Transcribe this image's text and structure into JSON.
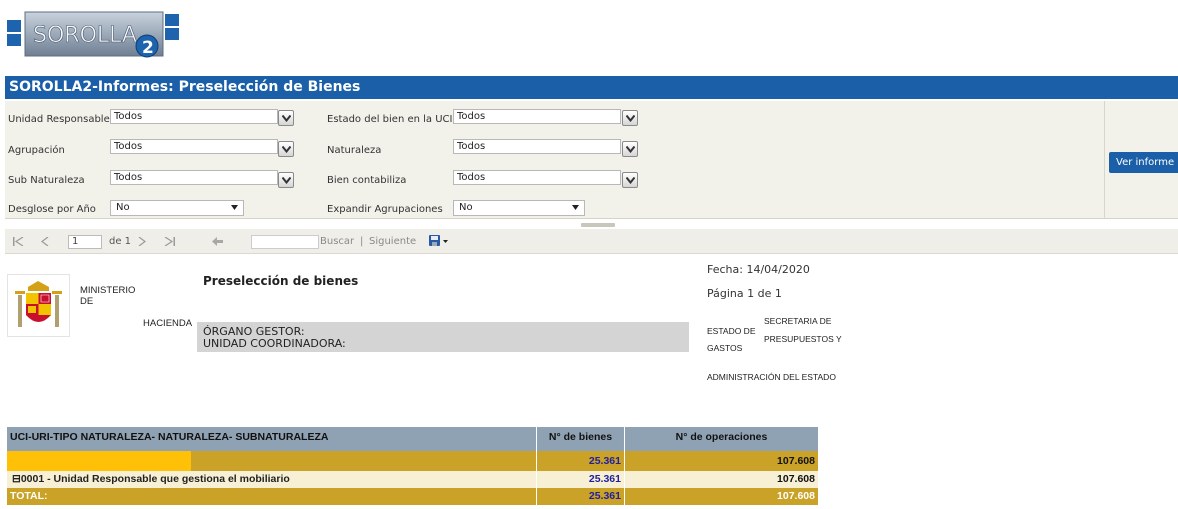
{
  "app": {
    "logo_text": "SOROLLA2",
    "title": "SOROLLA2-Informes: Preselección de Bienes"
  },
  "params": {
    "unidad_responsable": {
      "label": "Unidad Responsable",
      "value": "Todos"
    },
    "estado_bien": {
      "label": "Estado del bien en la UCI",
      "value": "Todos"
    },
    "agrupacion": {
      "label": "Agrupación",
      "value": "Todos"
    },
    "naturaleza": {
      "label": "Naturaleza",
      "value": "Todos"
    },
    "sub_naturaleza": {
      "label": "Sub Naturaleza",
      "value": "Todos"
    },
    "bien_contabiliza": {
      "label": "Bien contabiliza",
      "value": "Todos"
    },
    "desglose_anio": {
      "label": "Desglose por Año",
      "value": "No"
    },
    "expandir_agrupaciones": {
      "label": "Expandir Agrupaciones",
      "value": "No"
    },
    "ver_informe": "Ver informe"
  },
  "toolbar": {
    "first_icon": "first-page-icon",
    "prev_icon": "previous-page-icon",
    "page_value": "1",
    "page_of": "de 1",
    "next_icon": "next-page-icon",
    "last_icon": "last-page-icon",
    "back_icon": "back-icon",
    "find_placeholder": "",
    "buscar": "Buscar",
    "sep": "|",
    "siguiente": "Siguiente",
    "export_icon": "save-disk-icon"
  },
  "report": {
    "ministerio": "MINISTERIO",
    "de": "DE",
    "hacienda": "HACIENDA",
    "report_title": "Preselección de bienes",
    "organo_gestor": "ÓRGANO GESTOR:",
    "unidad_coordinadora": "UNIDAD COORDINADORA:",
    "fecha": "Fecha: 14/04/2020",
    "pagina": "Página 1 de 1",
    "estado_de": "ESTADO DE",
    "gastos": "GASTOS",
    "secretaria": "SECRETARIA DE",
    "presupuestos": "PRESUPUESTOS  Y",
    "administracion": "ADMINISTRACIÓN DEL ESTADO"
  },
  "table": {
    "headers": [
      "UCI-URI-TIPO NATURALEZA- NATURALEZA- SUBNATURALEZA",
      "N° de bienes",
      "N° de operaciones"
    ],
    "group_row": {
      "label": "",
      "bienes": "25.361",
      "operaciones": "107.608"
    },
    "item_row": {
      "expander": "⊟",
      "label": "0001 - Unidad Responsable que gestiona el mobiliario",
      "bienes": "25.361",
      "operaciones": "107.608"
    },
    "total_row": {
      "label": "TOTAL:",
      "bienes": "25.361",
      "operaciones": "107.608"
    }
  },
  "colors": {
    "brand_blue": "#1a5fa8",
    "header_gray_blue": "#8fa2b3",
    "gold": "#c9a227",
    "orange_highlight": "#ffc107",
    "light_yellow": "#f8f0d4",
    "number_blue": "#1f1fa0"
  }
}
